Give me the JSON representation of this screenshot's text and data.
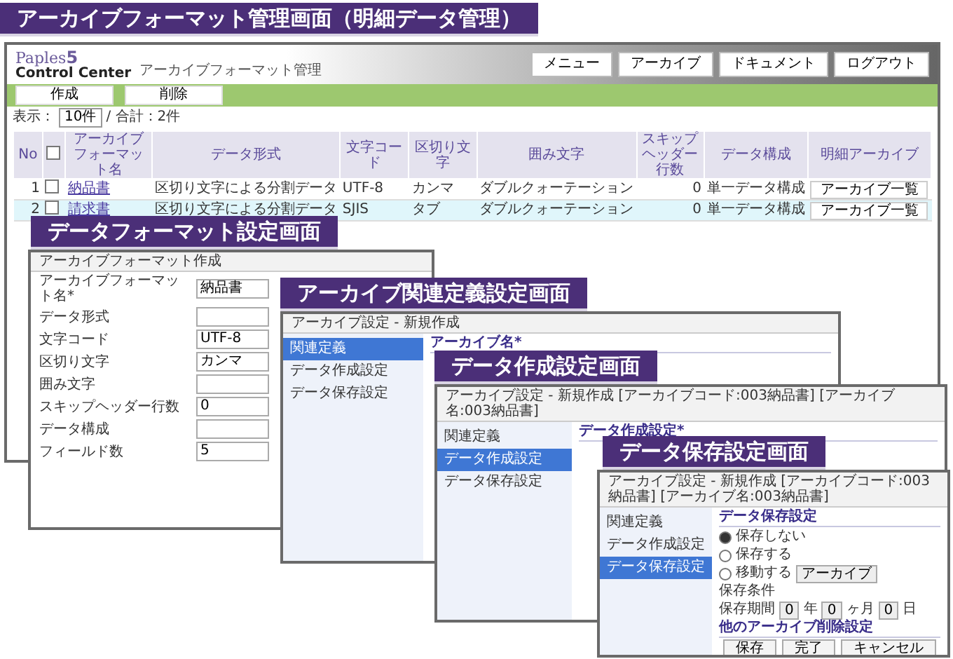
{
  "format_list": {
    "banner": "アーカイブフォーマット管理画面（明細データ管理）",
    "logo": {
      "name": "Paples",
      "number": "5",
      "sub": "Control Center"
    },
    "page_title": "アーカイブフォーマット管理",
    "menu": [
      "メニュー",
      "アーカイブ",
      "ドキュメント",
      "ログアウト"
    ],
    "actions": [
      "作成",
      "削除"
    ],
    "header_checked": false,
    "display_label": "表示：",
    "page_size": "10件",
    "total": "/ 合計：2件",
    "columns": [
      "No",
      "アーカイブフォーマット名",
      "データ形式",
      "文字コード",
      "区切り文字",
      "囲み文字",
      "スキップヘッダー行数",
      "データ構成",
      "明細アーカイブ"
    ],
    "rows": [
      {
        "no": "1",
        "checked": false,
        "selected": false,
        "name": "納品書",
        "format": "区切り文字による分割データ",
        "code": "UTF-8",
        "separator": "カンマ",
        "quote": "ダブルクォーテーション",
        "skip": "0",
        "structure": "単一データ構成",
        "action": "アーカイブ一覧"
      },
      {
        "no": "2",
        "checked": false,
        "selected": true,
        "name": "請求書",
        "format": "区切り文字による分割データ",
        "code": "SJIS",
        "separator": "タブ",
        "quote": "ダブルクォーテーション",
        "skip": "0",
        "structure": "単一データ構成",
        "action": "アーカイブ一覧"
      }
    ]
  },
  "format_edit": {
    "banner": "データフォーマット設定画面",
    "title": "アーカイブフォーマット作成",
    "fields": [
      {
        "label": "アーカイブフォーマット名*",
        "value": "納品書"
      },
      {
        "label": "データ形式"
      },
      {
        "label": "文字コード",
        "value": "UTF-8"
      },
      {
        "label": "区切り文字",
        "value": "カンマ"
      },
      {
        "label": "囲み文字"
      },
      {
        "label": "スキップヘッダー行数",
        "value": "0"
      },
      {
        "label": "データ構成"
      },
      {
        "label": "フィールド数",
        "value": "5"
      }
    ]
  },
  "archive_def": {
    "banner": "アーカイブ関連定義設定画面",
    "title": "アーカイブ設定 - 新規作成",
    "sidebar": [
      {
        "label": "関連定義",
        "selected": true
      },
      {
        "label": "データ作成設定",
        "selected": false
      },
      {
        "label": "データ保存設定",
        "selected": false
      }
    ],
    "heading": "アーカイブ名*"
  },
  "data_create": {
    "banner": "データ作成設定画面",
    "title": "アーカイブ設定 - 新規作成 [アーカイブコード:003納品書] [アーカイブ名:003納品書]",
    "sidebar": [
      {
        "label": "関連定義",
        "selected": false
      },
      {
        "label": "データ作成設定",
        "selected": true
      },
      {
        "label": "データ保存設定",
        "selected": false
      }
    ],
    "heading": "データ作成設定*"
  },
  "data_save": {
    "banner": "データ保存設定画面",
    "title": "アーカイブ設定 - 新規作成 [アーカイブコード:003納品書] [アーカイブ名:003納品書]",
    "sidebar": [
      {
        "label": "関連定義",
        "selected": false
      },
      {
        "label": "データ作成設定",
        "selected": false
      },
      {
        "label": "データ保存設定",
        "selected": true
      }
    ],
    "heading": "データ保存設定",
    "options": [
      {
        "label": "保存しない",
        "selected": true
      },
      {
        "label": "保存する",
        "selected": false
      },
      {
        "label": "移動する",
        "selected": false,
        "target": "アーカイブ"
      }
    ],
    "condition_label": "保存条件",
    "period": {
      "label": "保存期間",
      "parts": [
        {
          "value": "0",
          "unit": "年"
        },
        {
          "value": "0",
          "unit": "ヶ月"
        },
        {
          "value": "0",
          "unit": "日"
        }
      ]
    },
    "delete_heading": "他のアーカイブ削除設定",
    "buttons": [
      "保存",
      "完了",
      "キャンセル"
    ]
  }
}
